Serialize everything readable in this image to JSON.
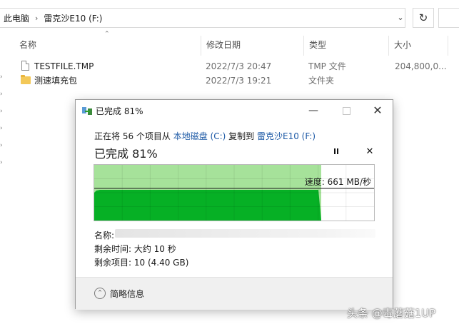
{
  "explorer": {
    "breadcrumb": [
      "此电脑",
      "雷克沙E10 (F:)"
    ],
    "columns": {
      "name": "名称",
      "date": "修改日期",
      "type": "类型",
      "size": "大小"
    },
    "files": [
      {
        "name": "TESTFILE.TMP",
        "date": "2022/7/3 20:47",
        "type": "TMP 文件",
        "size": "204,800,0...",
        "icon": "document-icon"
      },
      {
        "name": "测速填充包",
        "date": "2022/7/3 19:21",
        "type": "文件夹",
        "size": "",
        "icon": "folder-icon"
      }
    ]
  },
  "dialog": {
    "title": "已完成 81%",
    "copy_line": {
      "prefix": "正在将 56 个项目从",
      "source": "本地磁盘 (C:)",
      "middle": "复制到",
      "dest": "雷克沙E10 (F:)"
    },
    "heading": "已完成 81%",
    "speed": "速度: 661 MB/秒",
    "name_label": "名称:",
    "time_left": "剩余时间: 大约 10 秒",
    "items_left": "剩余项目: 10 (4.40 GB)",
    "more_info": "简略信息",
    "colors": {
      "progress_fill": "#a6e29a",
      "throughput_fill": "#06b025",
      "link": "#1e5aa6"
    }
  },
  "chart_data": {
    "type": "area",
    "progress_percent": 81,
    "current_speed": "661 MB/秒",
    "grid": true
  },
  "watermark": "头条 @毒蘑菇1UP"
}
